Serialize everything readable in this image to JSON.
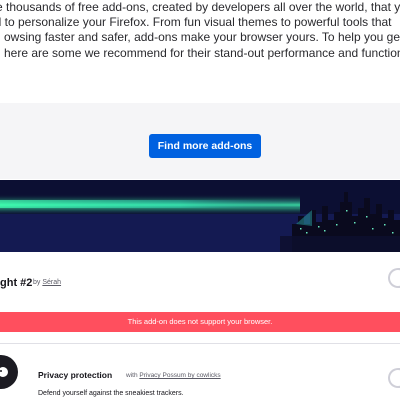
{
  "intro": {
    "line1": "e thousands of free add-ons, created by developers all over the world, that you",
    "line2": "ll to personalize your Firefox. From fun visual themes to powerful tools that",
    "line3": "owsing faster and safer, add-ons make your browser yours. To help you get",
    "line4": "here are some we recommend for their stand-out performance and functionalit"
  },
  "find_more_button": "Find more add-ons",
  "theme_addon": {
    "name": "ght #2",
    "by_prefix": "by",
    "author": "Sérah",
    "enabled": false,
    "warning": "This add-on does not support your browser."
  },
  "privacy_addon": {
    "name": "Privacy protection",
    "by_prefix": "with",
    "author": "Privacy Possum by cowlicks",
    "description": "Defend yourself against the sneakiest trackers.",
    "enabled": false
  },
  "colors": {
    "accent_blue": "#0061e0",
    "warning_red": "#ff4f5e",
    "theme_dark": "#0a0c2c",
    "theme_glow": "#3fffb0"
  }
}
